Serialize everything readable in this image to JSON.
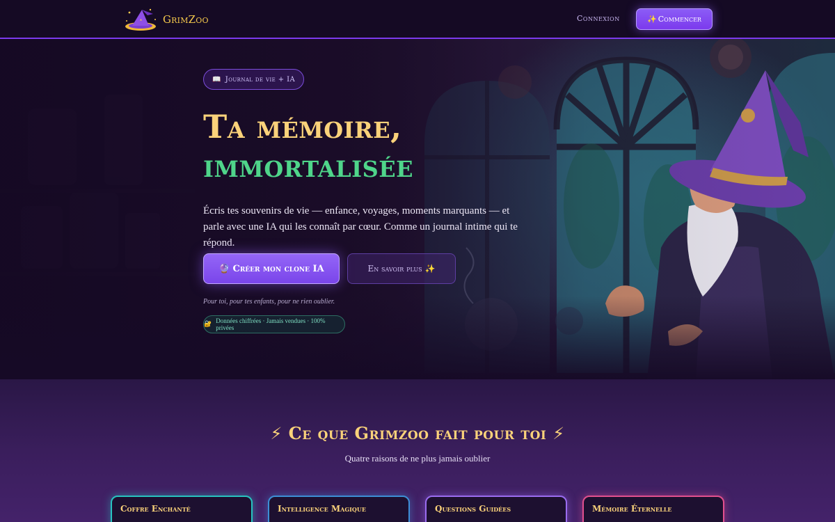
{
  "nav": {
    "logo_text": "GrimZoo",
    "login_label": "Connexion",
    "cta_icon": "✨",
    "cta_label": "Commencer"
  },
  "hero": {
    "badge_icon": "📖",
    "badge_label": "Journal de vie + IA",
    "title_line1": "Ta mémoire,",
    "title_line2": "immortalisée",
    "lead": "Écris tes souvenirs de vie — enfance, voyages, moments marquants — et parle avec une IA qui les connaît par cœur. Comme un journal intime qui te répond.",
    "primary_icon": "🔮",
    "primary_label": "Créer mon clone IA",
    "secondary_label": "En savoir plus",
    "secondary_icon": "✨",
    "tagline": "Pour toi, pour tes enfants, pour ne rien oublier.",
    "secure_icon": "🔐",
    "secure_label": "Données chiffrées · Jamais vendues · 100% privées"
  },
  "features": {
    "title_icon_left": "⚡",
    "title": "Ce que Grimzoo fait pour toi",
    "title_icon_right": "⚡",
    "subtitle": "Quatre raisons de ne plus jamais oublier",
    "cards": [
      {
        "title": "Coffre Enchanté"
      },
      {
        "title": "Intelligence Magique"
      },
      {
        "title": "Questions Guidées"
      },
      {
        "title": "Mémoire Éternelle"
      }
    ]
  },
  "colors": {
    "accent": "#7c3aed",
    "gold": "#fad27a",
    "green": "#4fd58a",
    "teal": "#27c4c0",
    "blue": "#3d8fd6",
    "violet": "#9a6cf0",
    "pink": "#e2508e"
  }
}
